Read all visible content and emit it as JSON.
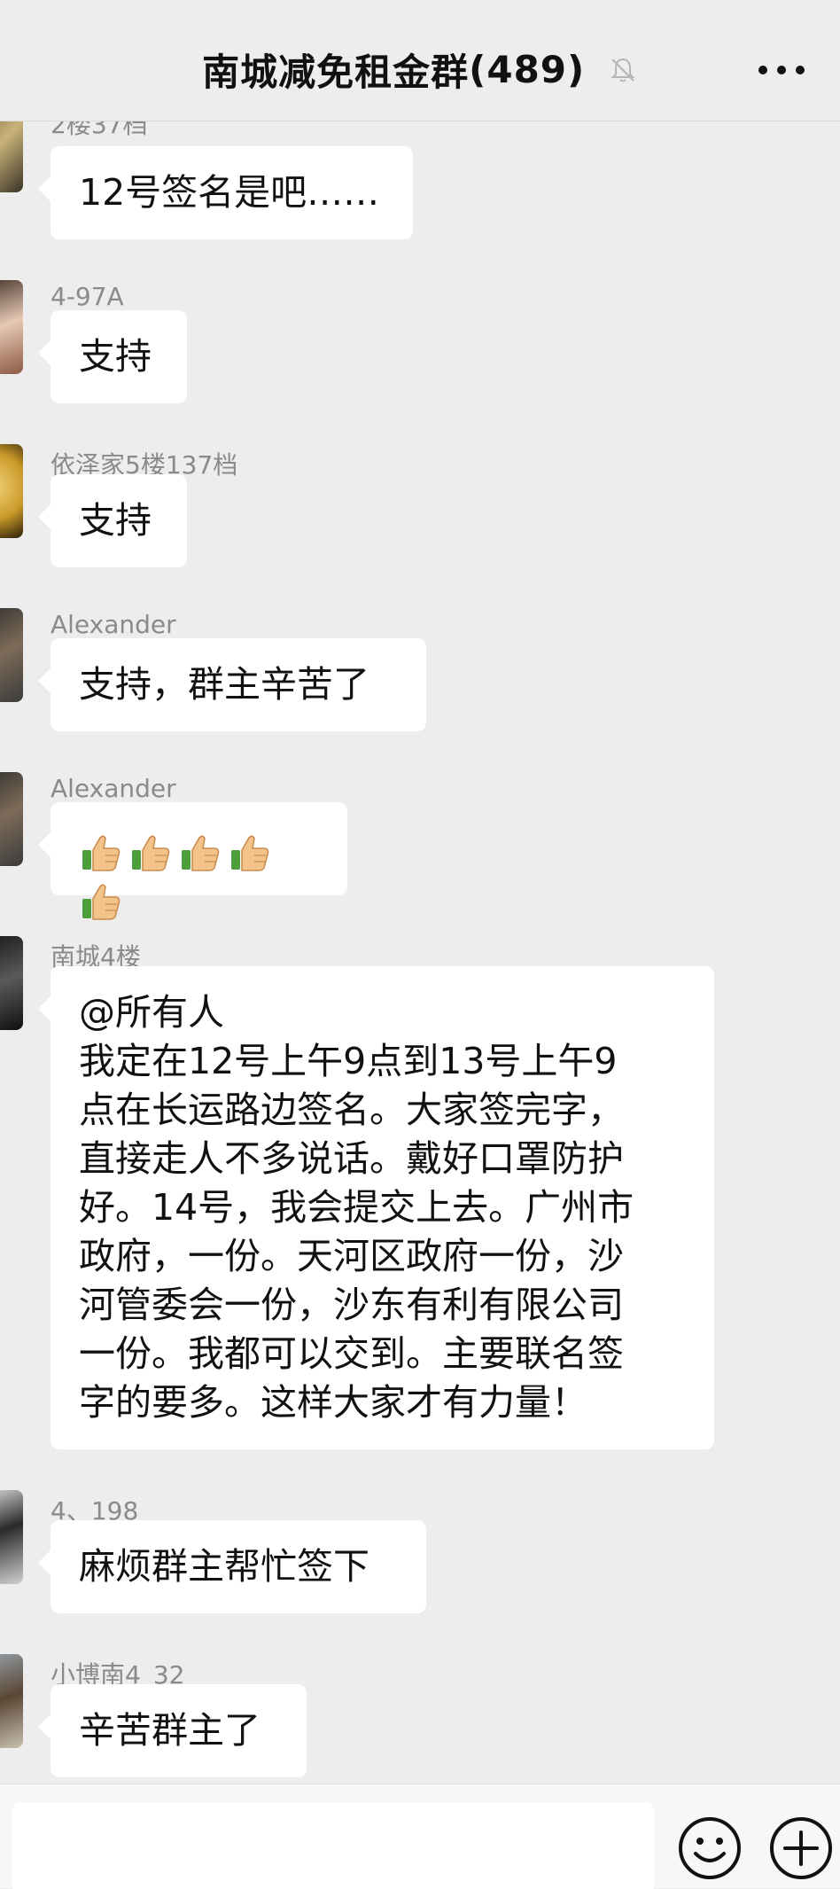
{
  "header": {
    "title": "南城减免租金群",
    "member_count": "(489)",
    "mute_icon": "bell-muted-icon",
    "more_icon": "more-dots-icon"
  },
  "messages": [
    {
      "sender": "2楼37档",
      "lines": [
        "12号签名是吧……"
      ]
    },
    {
      "sender": "4-97A",
      "lines": [
        "支持"
      ]
    },
    {
      "sender": "依泽家5楼137档",
      "lines": [
        "支持"
      ]
    },
    {
      "sender": "Alexander",
      "lines": [
        "支持，群主辛苦了"
      ]
    },
    {
      "sender": "Alexander",
      "emoji": "thumbs-up",
      "emoji_count": 5
    },
    {
      "sender": "南城4楼",
      "lines": [
        "@所有人",
        "我定在12号上午9点到13号上午9",
        "点在长运路边签名。大家签完字，",
        "直接走人不多说话。戴好口罩防护",
        "好。14号，我会提交上去。广州市",
        "政府，一份。天河区政府一份，沙",
        "河管委会一份，沙东有利有限公司",
        "一份。我都可以交到。主要联名签",
        "字的要多。这样大家才有力量！"
      ]
    },
    {
      "sender": "4、198",
      "lines": [
        "麻烦群主帮忙签下"
      ]
    },
    {
      "sender": "小博南4_32",
      "lines": [
        "辛苦群主了"
      ]
    }
  ],
  "bottombar": {
    "input_placeholder": "",
    "emoji_icon": "emoji-smile-icon",
    "plus_icon": "plus-circle-icon"
  },
  "colors": {
    "background": "#ededed",
    "bubble": "#ffffff",
    "sender_text": "#8a8a8a"
  }
}
